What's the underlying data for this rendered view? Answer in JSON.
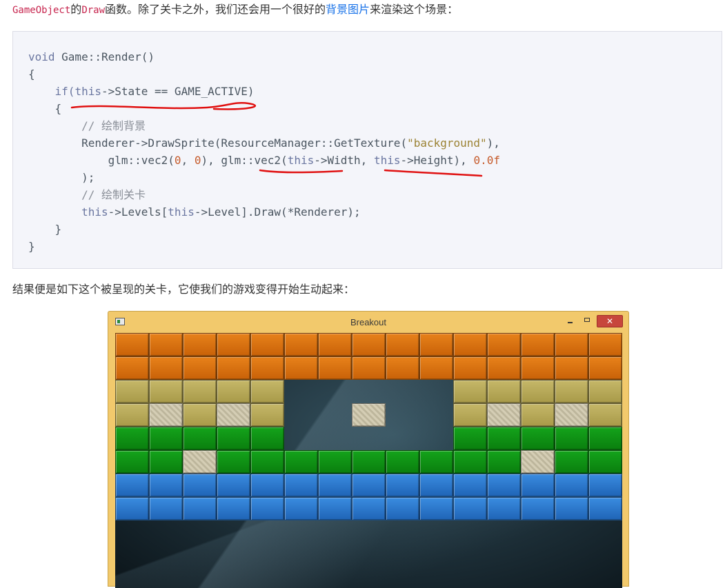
{
  "intro": {
    "code1": "GameObject",
    "text1": "的",
    "code2": "Draw",
    "text2": "函数。除了关卡之外，我们还会用一个很好的",
    "link": "背景图片",
    "text3": "来渲染这个场景："
  },
  "code": {
    "l1_kw": "void",
    "l1_rest": " Game::Render()",
    "l2": "{",
    "l3_kw1": "if",
    "l3_p1": "(",
    "l3_kw2": "this",
    "l3_rest": "->State == GAME_ACTIVE)",
    "l4": "{",
    "l5": "// 绘制背景",
    "l6_a": "Renderer->DrawSprite(ResourceManager::GetTexture(",
    "l6_str": "\"background\"",
    "l6_b": "),",
    "l7_a": "glm::vec2(",
    "l7_n1": "0",
    "l7_b": ", ",
    "l7_n2": "0",
    "l7_c": "), glm::vec2(",
    "l7_kw1": "this",
    "l7_d": "->Width, ",
    "l7_kw2": "this",
    "l7_e": "->Height), ",
    "l7_n3": "0.0f",
    "l8": ");",
    "l9": "// 绘制关卡",
    "l10_kw1": "this",
    "l10_a": "->Levels[",
    "l10_kw2": "this",
    "l10_b": "->Level].Draw(*Renderer);",
    "l11": "}",
    "l12": "}"
  },
  "result_text": "结果便是如下这个被呈现的关卡，它使我们的游戏变得开始生动起来：",
  "window": {
    "title": "Breakout",
    "close_glyph": "✕"
  },
  "level": {
    "grid": [
      "OOOOOOOOOOOOOOO",
      "OOOOOOOOOOOOOOO",
      "TTTTT.....TTTTT",
      "TSTST..S..TSTST",
      "GGGGG.....GGGGG",
      "GGSGGGGGGGGGSGG",
      "BBBBBBBBBBBBBBB",
      "BBBBBBBBBBBBBBB"
    ],
    "colors": {
      "O": "orange",
      "T": "tan",
      "G": "green",
      "B": "blue",
      "S": "solid"
    }
  }
}
